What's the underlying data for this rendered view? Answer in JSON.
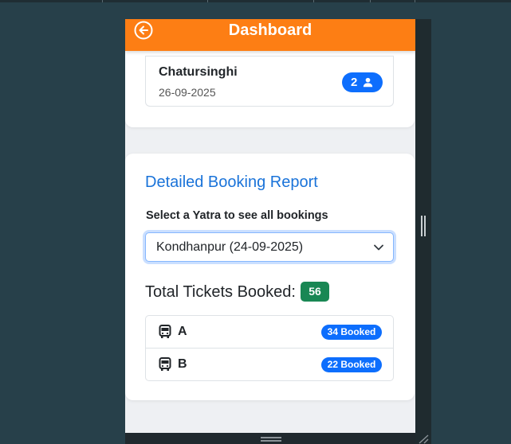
{
  "header": {
    "title": "Dashboard",
    "back_icon": "arrow-left-circle-icon"
  },
  "recent_yatra": {
    "name": "Chatursinghi",
    "date": "26-09-2025",
    "count": "2",
    "count_icon": "person-icon"
  },
  "report": {
    "title": "Detailed Booking Report",
    "select_label": "Select a Yatra to see all bookings",
    "selected_yatra": "Kondhanpur (24-09-2025)",
    "total_label": "Total Tickets Booked:",
    "total_value": "56",
    "buses": [
      {
        "name": "A",
        "booked": "34 Booked",
        "icon": "bus-icon"
      },
      {
        "name": "B",
        "booked": "22 Booked",
        "icon": "bus-icon"
      }
    ]
  },
  "colors": {
    "header": "#fd7e14",
    "primary": "#0d6efd",
    "success": "#198754",
    "report_title": "#1a73d9",
    "background": "#27404a"
  }
}
